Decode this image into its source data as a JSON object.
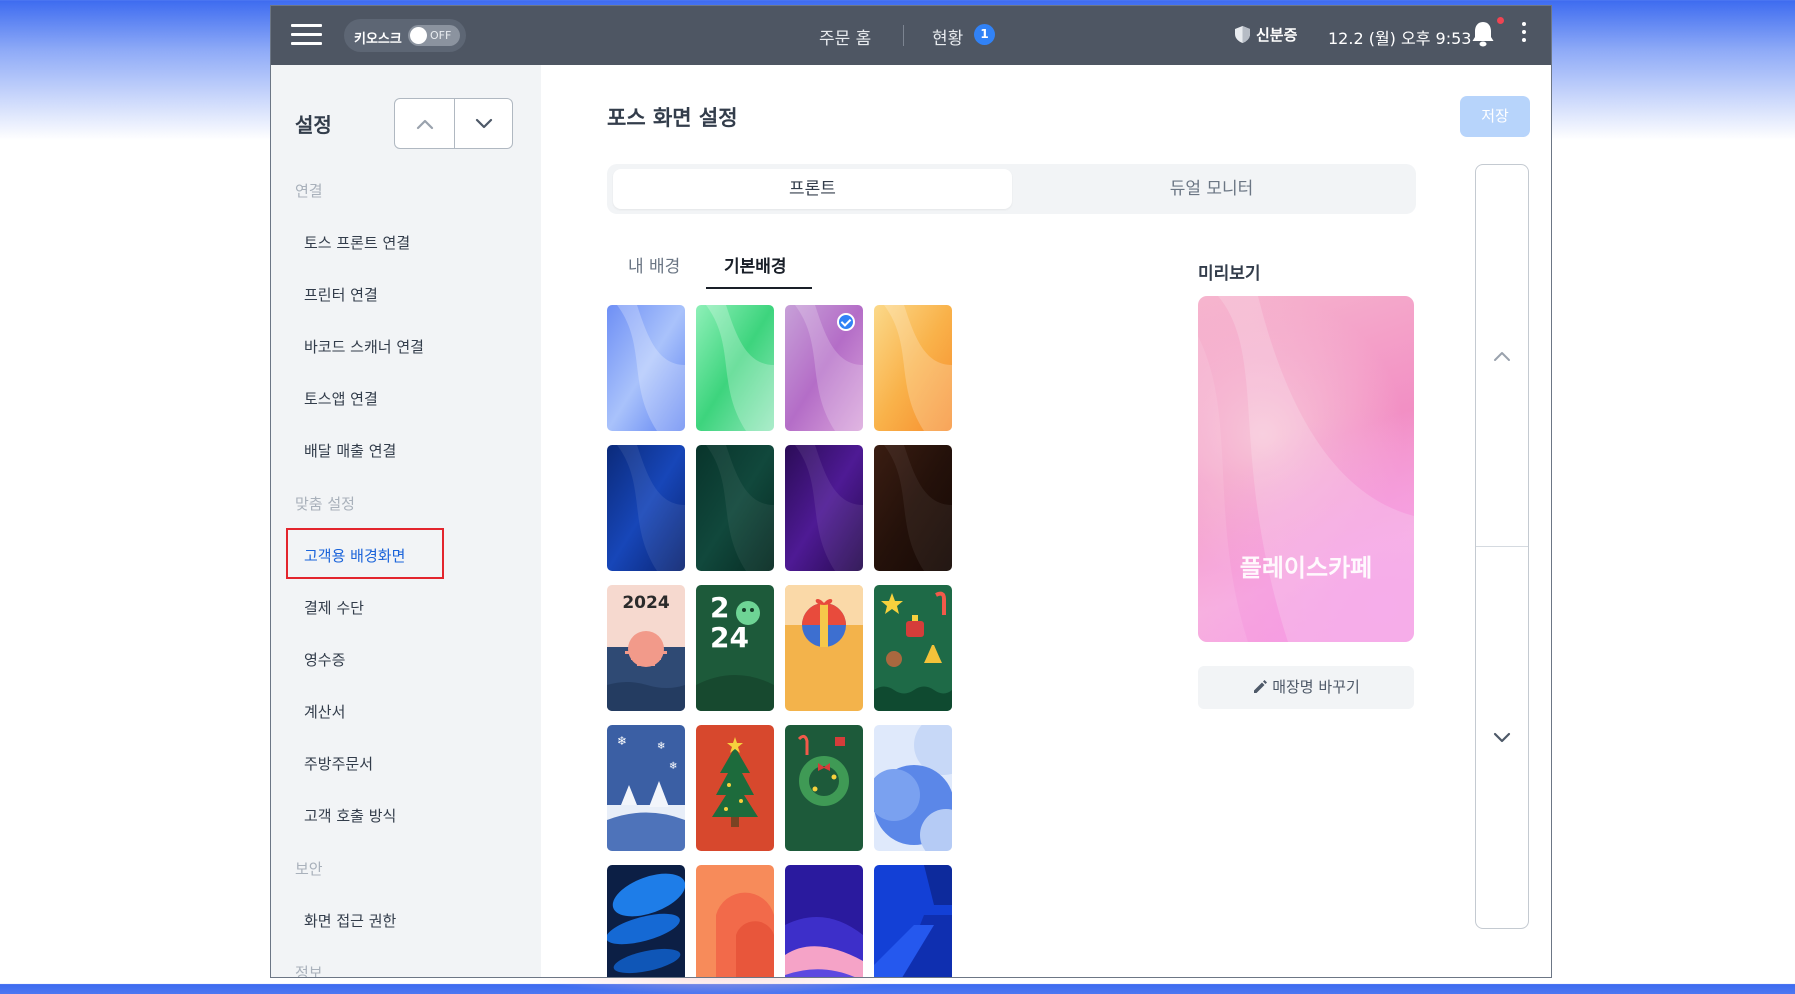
{
  "topbar": {
    "kiosk_label": "키오스크",
    "kiosk_toggle": "OFF",
    "nav_order_home": "주문 홈",
    "nav_status": "현황",
    "status_badge": "1",
    "id_card": "신분증",
    "datetime": "12.2 (월) 오후 9:53"
  },
  "sidebar": {
    "title": "설정",
    "sections": {
      "connect": "연결",
      "custom": "맞춤 설정",
      "security": "보안",
      "info": "정보"
    },
    "items": {
      "toss_front": "토스 프론트 연결",
      "printer": "프린터 연결",
      "barcode": "바코드 스캐너 연결",
      "tossapp": "토스앱 연결",
      "delivery": "배달 매출 연결",
      "customer_bg": "고객용 배경화면",
      "payment": "결제 수단",
      "receipt": "영수증",
      "invoice": "계산서",
      "kitchen": "주방주문서",
      "call": "고객 호출 방식",
      "access": "화면 접근 권한"
    }
  },
  "main": {
    "title": "포스 화면 설정",
    "save_label": "저장",
    "segments": [
      "프론트",
      "듀얼 모니터"
    ],
    "subtabs": [
      "내 배경",
      "기본배경"
    ],
    "preview_label": "미리보기",
    "preview_store_name": "플레이스카페",
    "rename_label": "매장명 바꾸기",
    "thumb_2024_text": "2024",
    "thumb_24_text_a": "2",
    "thumb_24_text_b": "24"
  },
  "colors": {
    "accent": "#3182f6",
    "topbar": "#4e5663",
    "sidebar": "#f2f4f6",
    "highlight_box": "#e3252d"
  }
}
